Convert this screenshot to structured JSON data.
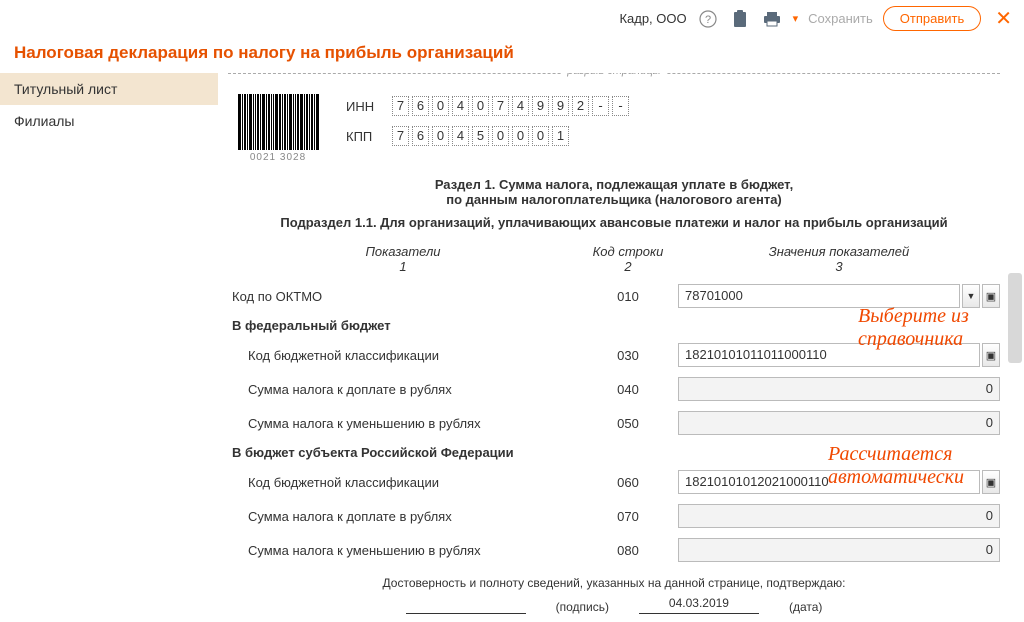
{
  "toolbar": {
    "company": "Кадр, ООО",
    "save": "Сохранить",
    "send": "Отправить"
  },
  "title": "Налоговая декларация по налогу на прибыль организаций",
  "sidebar": {
    "tab_title": "Титульный лист",
    "tab_branches": "Филиалы"
  },
  "page_break": "разрыв страницы",
  "barcode": "0021 3028",
  "ids": {
    "inn_label": "ИНН",
    "inn": [
      "7",
      "6",
      "0",
      "4",
      "0",
      "7",
      "4",
      "9",
      "9",
      "2",
      "-",
      "-"
    ],
    "kpp_label": "КПП",
    "kpp": [
      "7",
      "6",
      "0",
      "4",
      "5",
      "0",
      "0",
      "0",
      "1"
    ]
  },
  "section": {
    "line1": "Раздел 1. Сумма налога, подлежащая уплате в бюджет,",
    "line2": "по данным налогоплательщика (налогового агента)",
    "sub": "Подраздел 1.1. Для организаций, уплачивающих авансовые платежи и налог на прибыль организаций"
  },
  "cols": {
    "c1": "Показатели",
    "c1n": "1",
    "c2": "Код строки",
    "c2n": "2",
    "c3": "Значения показателей",
    "c3n": "3"
  },
  "rows": {
    "oktmo": {
      "label": "Код по ОКТМО",
      "code": "010",
      "value": "78701000"
    },
    "fed_header": "В федеральный бюджет",
    "kbk_fed": {
      "label": "Код бюджетной классификации",
      "code": "030",
      "value": "18210101011011000110"
    },
    "sum_add_fed": {
      "label": "Сумма налога к доплате в рублях",
      "code": "040",
      "value": "0"
    },
    "sum_dec_fed": {
      "label": "Сумма налога к уменьшению в рублях",
      "code": "050",
      "value": "0"
    },
    "reg_header": "В бюджет субъекта Российской Федерации",
    "kbk_reg": {
      "label": "Код бюджетной классификации",
      "code": "060",
      "value": "18210101012021000110"
    },
    "sum_add_reg": {
      "label": "Сумма налога к доплате в рублях",
      "code": "070",
      "value": "0"
    },
    "sum_dec_reg": {
      "label": "Сумма налога к уменьшению в рублях",
      "code": "080",
      "value": "0"
    }
  },
  "annotations": {
    "pick": "Выберите из справочника",
    "auto": "Рассчитается автоматически"
  },
  "footer": {
    "confirm": "Достоверность и полноту сведений, указанных на данной странице, подтверждаю:",
    "sign": "(подпись)",
    "date_value": "04.03.2019",
    "date_label": "(дата)"
  }
}
